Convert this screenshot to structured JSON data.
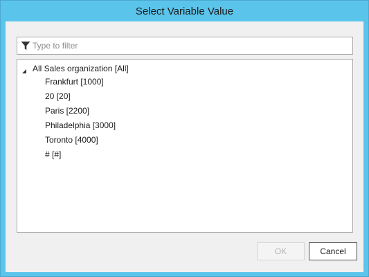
{
  "window": {
    "title": "Select Variable Value"
  },
  "filter": {
    "placeholder": "Type to filter",
    "value": "",
    "icon": "filter-icon"
  },
  "tree": {
    "root": {
      "label": "All Sales organization [All]",
      "expanded": true
    },
    "children": [
      {
        "label": "Frankfurt [1000]"
      },
      {
        "label": "20 [20]"
      },
      {
        "label": "Paris [2200]"
      },
      {
        "label": "Philadelphia [3000]"
      },
      {
        "label": "Toronto [4000]"
      },
      {
        "label": "# [#]"
      }
    ]
  },
  "buttons": {
    "ok": {
      "label": "OK",
      "enabled": false
    },
    "cancel": {
      "label": "Cancel"
    }
  },
  "colors": {
    "frame": "#5bc4ea",
    "client": "#f0f0f0"
  }
}
